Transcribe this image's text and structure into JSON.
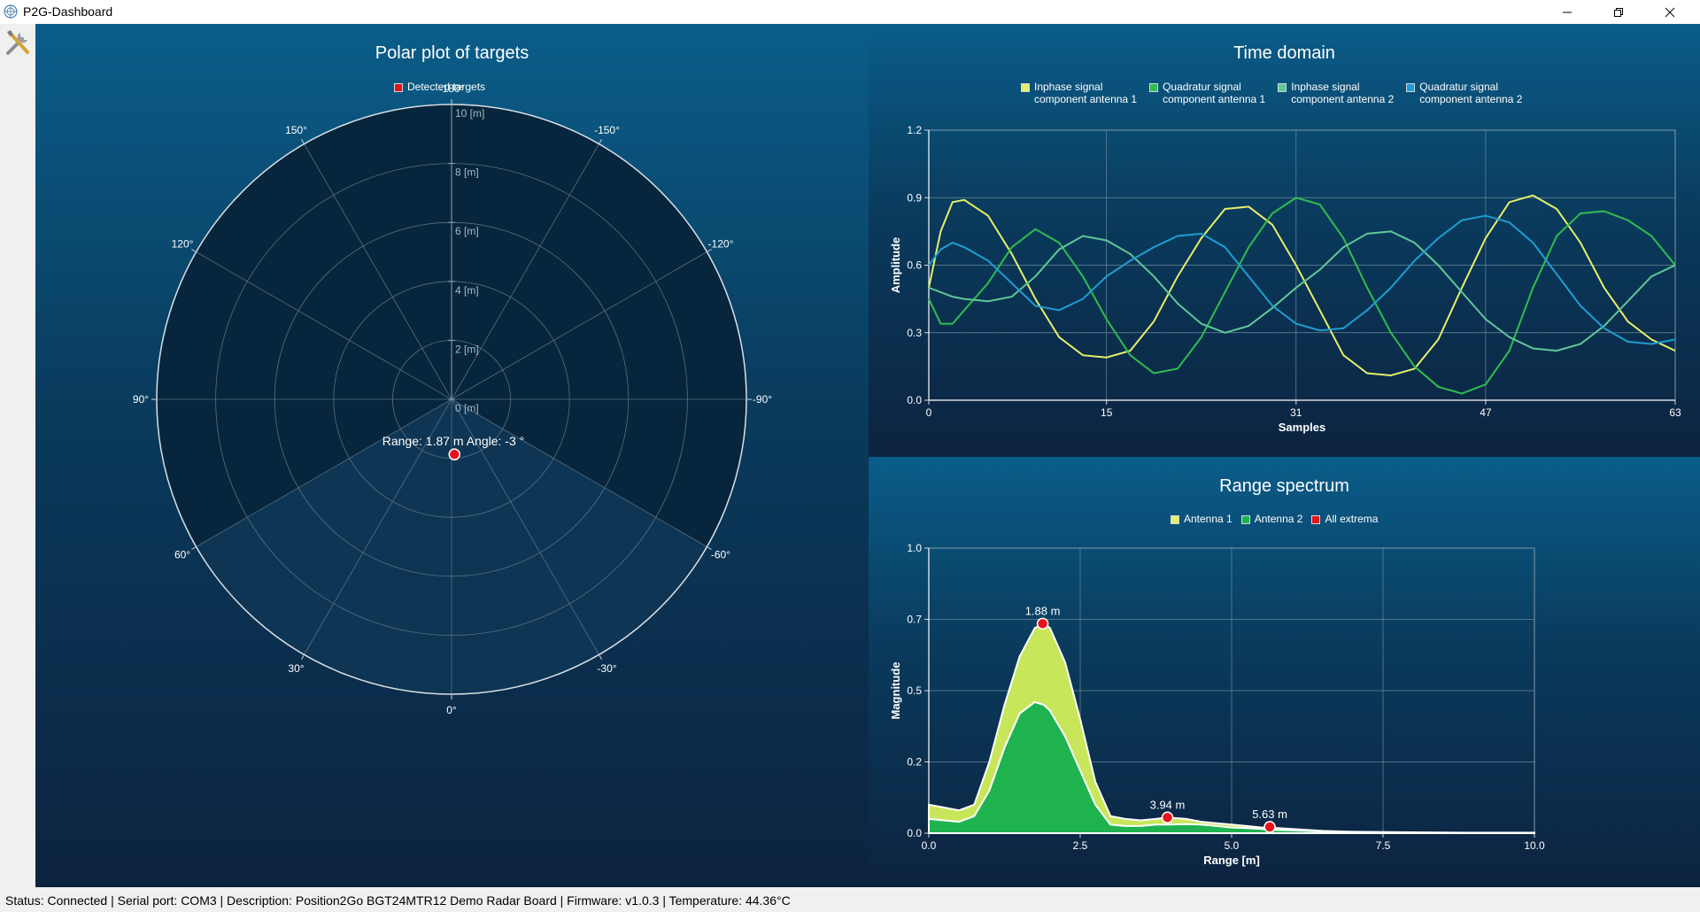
{
  "window": {
    "title": "P2G-Dashboard"
  },
  "toolbar": {
    "settings_icon": "tools-icon"
  },
  "polar": {
    "title": "Polar plot of targets",
    "legend": "Detected targets",
    "colors": {
      "target": "#e8121a",
      "legend_swatch": "#e8121a"
    }
  },
  "status_bar": {
    "text": "Status: Connected  |  Serial port: COM3  |  Description: Position2Go BGT24MTR12 Demo Radar Board  |  Firmware: v1.0.3  |  Temperature: 44.36°C"
  },
  "chart_data": [
    {
      "type": "scatter",
      "name": "polar",
      "title": "Polar plot of targets",
      "coordinate_system": "polar",
      "angle_ticks": [
        "-180°",
        "-150°",
        "-120°",
        "-90°",
        "-60°",
        "-30°",
        "0°",
        "30°",
        "60°",
        "90°",
        "120°",
        "150°"
      ],
      "angle_tick_values": [
        -180,
        -150,
        -120,
        -90,
        -60,
        -30,
        0,
        30,
        60,
        90,
        120,
        150
      ],
      "radial_ticks": [
        "0 [m]",
        "2 [m]",
        "4 [m]",
        "6 [m]",
        "8 [m]",
        "10 [m]"
      ],
      "radial_tick_values": [
        0,
        2,
        4,
        6,
        8,
        10
      ],
      "rlim": [
        0,
        10
      ],
      "highlighted_sector_deg": [
        -60,
        60
      ],
      "legend": [
        "Detected targets"
      ],
      "points": [
        {
          "range": 1.87,
          "angle": -3,
          "label": "Range: 1.87 m Angle: -3 °"
        }
      ]
    },
    {
      "type": "line",
      "name": "time",
      "title": "Time domain",
      "xlabel": "Samples",
      "ylabel": "Amplitude",
      "xlim": [
        0,
        63
      ],
      "ylim": [
        0,
        1.2
      ],
      "x_ticks": [
        "0",
        "15",
        "31",
        "47",
        "63"
      ],
      "x_tick_values": [
        0,
        15,
        31,
        47,
        63
      ],
      "y_ticks": [
        "0.0",
        "0.3",
        "0.6",
        "0.9",
        "1.2"
      ],
      "y_tick_values": [
        0,
        0.3,
        0.6,
        0.9,
        1.2
      ],
      "grid": true,
      "legend_position": "top",
      "series": [
        {
          "name": "Inphase signal component antenna 1",
          "legend_lines": [
            "Inphase signal",
            "component antenna 1"
          ],
          "color": "#e6ef6a",
          "x": [
            0,
            1,
            2,
            3,
            5,
            7,
            9,
            11,
            13,
            15,
            17,
            19,
            21,
            23,
            25,
            27,
            29,
            31,
            33,
            35,
            37,
            39,
            41,
            43,
            45,
            47,
            49,
            51,
            53,
            55,
            57,
            59,
            61,
            63
          ],
          "values": [
            0.5,
            0.75,
            0.88,
            0.89,
            0.82,
            0.65,
            0.45,
            0.28,
            0.2,
            0.19,
            0.22,
            0.35,
            0.55,
            0.72,
            0.85,
            0.86,
            0.78,
            0.6,
            0.4,
            0.2,
            0.12,
            0.11,
            0.14,
            0.27,
            0.5,
            0.72,
            0.88,
            0.91,
            0.85,
            0.7,
            0.5,
            0.35,
            0.27,
            0.22
          ]
        },
        {
          "name": "Quadratur signal component antenna 1",
          "legend_lines": [
            "Quadratur signal",
            "component antenna 1"
          ],
          "color": "#2fbd4e",
          "x": [
            0,
            1,
            2,
            3,
            5,
            7,
            9,
            11,
            13,
            15,
            17,
            19,
            21,
            23,
            25,
            27,
            29,
            31,
            33,
            35,
            37,
            39,
            41,
            43,
            45,
            47,
            49,
            51,
            53,
            55,
            57,
            59,
            61,
            63
          ],
          "values": [
            0.45,
            0.34,
            0.34,
            0.4,
            0.52,
            0.68,
            0.76,
            0.7,
            0.55,
            0.36,
            0.2,
            0.12,
            0.14,
            0.28,
            0.48,
            0.68,
            0.83,
            0.9,
            0.87,
            0.72,
            0.5,
            0.3,
            0.15,
            0.06,
            0.03,
            0.07,
            0.22,
            0.5,
            0.73,
            0.83,
            0.84,
            0.8,
            0.73,
            0.6
          ]
        },
        {
          "name": "Inphase signal component antenna 2",
          "legend_lines": [
            "Inphase signal",
            "component antenna 2"
          ],
          "color": "#5fc897",
          "x": [
            0,
            1,
            2,
            3,
            5,
            7,
            9,
            11,
            13,
            15,
            17,
            19,
            21,
            23,
            25,
            27,
            29,
            31,
            33,
            35,
            37,
            39,
            41,
            43,
            45,
            47,
            49,
            51,
            53,
            55,
            57,
            59,
            61,
            63
          ],
          "values": [
            0.5,
            0.48,
            0.46,
            0.45,
            0.44,
            0.46,
            0.55,
            0.67,
            0.73,
            0.71,
            0.65,
            0.55,
            0.43,
            0.34,
            0.3,
            0.33,
            0.41,
            0.5,
            0.58,
            0.68,
            0.74,
            0.75,
            0.7,
            0.6,
            0.48,
            0.36,
            0.28,
            0.23,
            0.22,
            0.25,
            0.33,
            0.44,
            0.55,
            0.6
          ]
        },
        {
          "name": "Quadratur signal component antenna 2",
          "legend_lines": [
            "Quadratur signal",
            "component antenna 2"
          ],
          "color": "#1e9ed2",
          "x": [
            0,
            1,
            2,
            3,
            5,
            7,
            9,
            11,
            13,
            15,
            17,
            19,
            21,
            23,
            25,
            27,
            29,
            31,
            33,
            35,
            37,
            39,
            41,
            43,
            45,
            47,
            49,
            51,
            53,
            55,
            57,
            59,
            61,
            63
          ],
          "values": [
            0.6,
            0.67,
            0.7,
            0.68,
            0.62,
            0.52,
            0.42,
            0.4,
            0.45,
            0.55,
            0.62,
            0.68,
            0.73,
            0.74,
            0.68,
            0.55,
            0.42,
            0.34,
            0.31,
            0.32,
            0.4,
            0.5,
            0.62,
            0.72,
            0.8,
            0.82,
            0.79,
            0.7,
            0.56,
            0.42,
            0.32,
            0.26,
            0.25,
            0.27
          ]
        }
      ]
    },
    {
      "type": "area",
      "name": "range",
      "title": "Range spectrum",
      "xlabel": "Range [m]",
      "ylabel": "Magnitude",
      "xlim": [
        0,
        10
      ],
      "ylim": [
        0,
        1.0
      ],
      "x_ticks": [
        "0.0",
        "2.5",
        "5.0",
        "7.5",
        "10.0"
      ],
      "x_tick_values": [
        0,
        2.5,
        5,
        7.5,
        10
      ],
      "y_ticks": [
        "0.0",
        "0.2",
        "0.5",
        "0.7",
        "1.0"
      ],
      "y_tick_values": [
        0,
        0.25,
        0.5,
        0.75,
        1.0
      ],
      "grid": true,
      "legend_position": "top",
      "x": [
        0,
        0.25,
        0.5,
        0.75,
        1.0,
        1.25,
        1.5,
        1.75,
        1.9,
        2.0,
        2.25,
        2.5,
        2.75,
        3.0,
        3.25,
        3.5,
        3.75,
        3.94,
        4.25,
        4.5,
        4.75,
        5.0,
        5.25,
        5.5,
        5.63,
        6.0,
        6.5,
        7.0,
        8.0,
        9.0,
        10.0
      ],
      "series": [
        {
          "name": "Antenna 1",
          "color": "#c8e65a",
          "values": [
            0.1,
            0.09,
            0.08,
            0.1,
            0.25,
            0.45,
            0.62,
            0.72,
            0.735,
            0.72,
            0.6,
            0.4,
            0.18,
            0.06,
            0.05,
            0.045,
            0.05,
            0.055,
            0.05,
            0.04,
            0.035,
            0.03,
            0.025,
            0.02,
            0.02,
            0.015,
            0.008,
            0.005,
            0.003,
            0.002,
            0.002
          ]
        },
        {
          "name": "Antenna 2",
          "color": "#1fb350",
          "values": [
            0.05,
            0.045,
            0.04,
            0.06,
            0.15,
            0.3,
            0.42,
            0.46,
            0.45,
            0.43,
            0.34,
            0.22,
            0.1,
            0.03,
            0.025,
            0.025,
            0.03,
            0.03,
            0.032,
            0.03,
            0.025,
            0.02,
            0.018,
            0.015,
            0.012,
            0.01,
            0.006,
            0.004,
            0.002,
            0.001,
            0.001
          ]
        }
      ],
      "extrema": [
        {
          "x": 1.88,
          "y": 0.735,
          "label": "1.88 m"
        },
        {
          "x": 3.94,
          "y": 0.055,
          "label": "3.94 m"
        },
        {
          "x": 5.63,
          "y": 0.022,
          "label": "5.63 m"
        }
      ],
      "extrema_legend": "All extrema",
      "extrema_color": "#e8121a"
    }
  ]
}
